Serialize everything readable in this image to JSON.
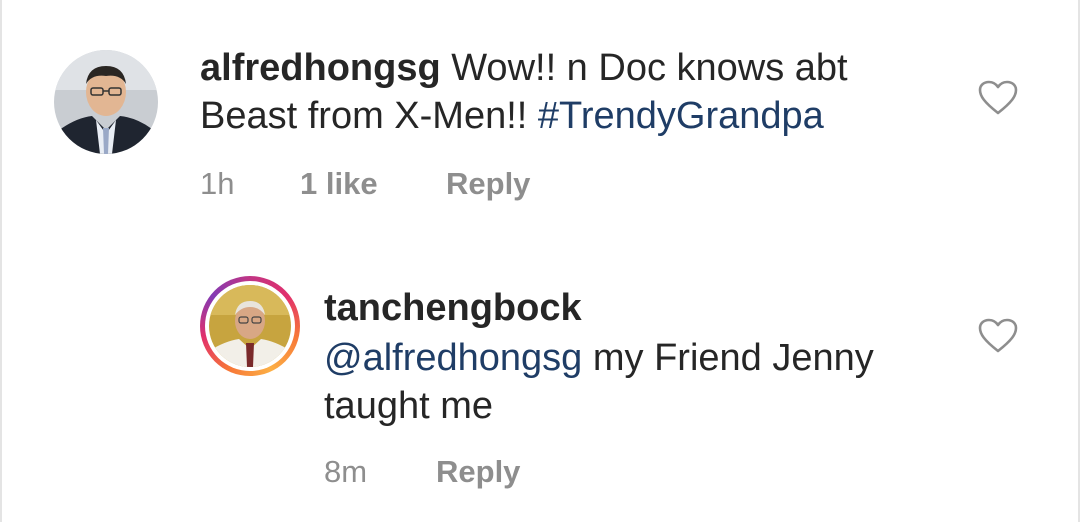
{
  "comments": [
    {
      "username": "alfredhongsg",
      "text": "Wow!! n Doc knows abt Beast from X-Men!!",
      "hashtag": "#TrendyGrandpa",
      "time": "1h",
      "likes": "1 like",
      "reply_label": "Reply",
      "has_story_ring": false
    },
    {
      "username": "tanchengbock",
      "mention": "@alfredhongsg",
      "text": "my Friend Jenny taught me",
      "time": "8m",
      "reply_label": "Reply",
      "has_story_ring": true
    }
  ],
  "colors": {
    "text": "#262626",
    "muted": "#8e8e8e",
    "link": "#1f3d66"
  }
}
